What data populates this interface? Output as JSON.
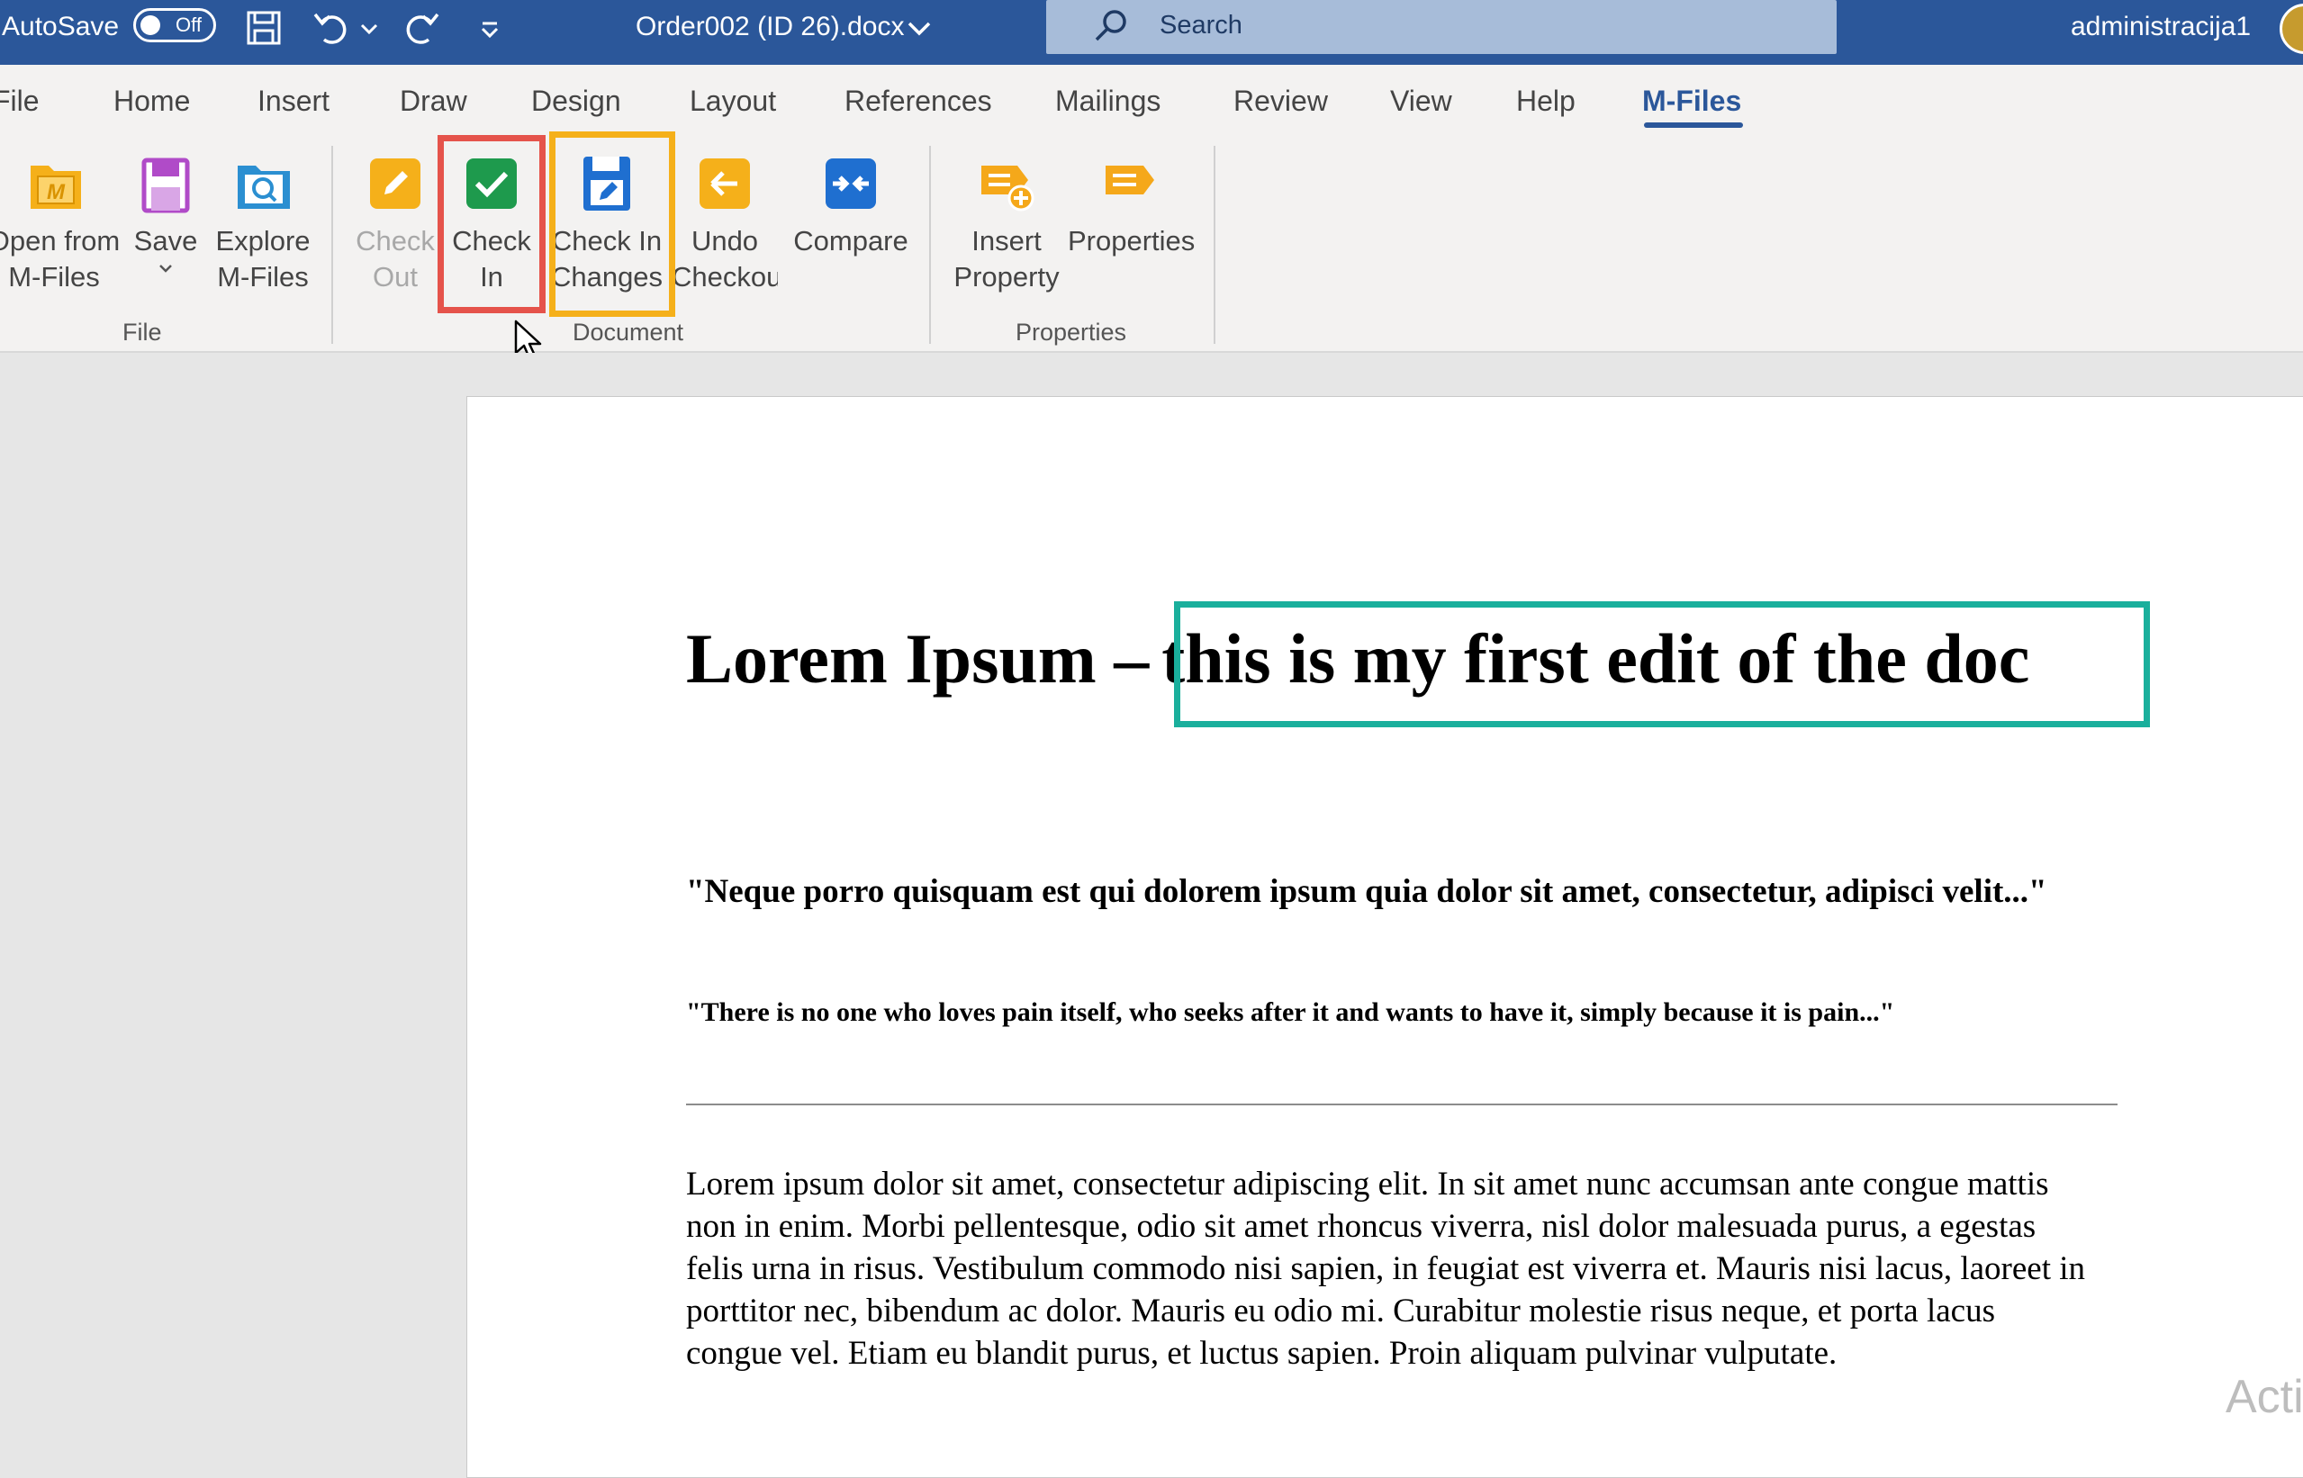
{
  "titlebar": {
    "autosave_label": "AutoSave",
    "autosave_state": "Off",
    "filename": "Order002 (ID 26).docx",
    "search_placeholder": "Search",
    "user_name": "administracija1",
    "icons": [
      "save-icon",
      "undo-icon",
      "undo-dropdown-icon",
      "redo-icon",
      "customize-quick-access-icon",
      "filename-dropdown-icon",
      "search-icon"
    ]
  },
  "tabs": {
    "file": "File",
    "home": "Home",
    "insert": "Insert",
    "draw": "Draw",
    "design": "Design",
    "layout": "Layout",
    "references": "References",
    "mailings": "Mailings",
    "review": "Review",
    "view": "View",
    "help": "Help",
    "mfiles": "M-Files",
    "active": "M-Files"
  },
  "ribbon": {
    "open_from_line1": "Open from",
    "open_from_line2": "M-Files",
    "save": "Save",
    "explore_line1": "Explore",
    "explore_line2": "M-Files",
    "group_file": "File",
    "checkout_line1": "Check",
    "checkout_line2": "Out",
    "checkin_line1": "Check",
    "checkin_line2": "In",
    "checkin_changes_line1": "Check In",
    "checkin_changes_line2": "Changes",
    "undo_checkout_line1": "Undo",
    "undo_checkout_line2": "Checkout",
    "compare": "Compare",
    "group_document": "Document",
    "insert_property_line1": "Insert",
    "insert_property_line2": "Property",
    "properties": "Properties",
    "group_properties": "Properties",
    "colors": {
      "mfiles_yellow": "#f5b01a",
      "save_purple": "#b04bc8",
      "explore_blue": "#2b8fd1",
      "checkin_green": "#1e9a4d",
      "checkin_changes_blue": "#1f6fd0",
      "compare_blue": "#1f6fd0",
      "property_orange": "#f5a81a"
    }
  },
  "document": {
    "title_main": "Lorem Ipsum –",
    "title_edit": "this is my first edit of the doc",
    "quote1": "\"Neque porro quisquam est qui dolorem ipsum quia dolor sit amet, consectetur, adipisci velit...\"",
    "quote2": "\"There is no one who loves pain itself, who seeks after it and wants to have it, simply because it is pain...\"",
    "body": "Lorem ipsum dolor sit amet, consectetur adipiscing elit. In sit amet nunc accumsan ante congue mattis non in enim. Morbi pellentesque, odio sit amet rhoncus viverra, nisl dolor malesuada purus, a egestas felis urna in risus. Vestibulum commodo nisi sapien, in feugiat est viverra et. Mauris nisi lacus, laoreet in porttitor nec, bibendum ac dolor. Mauris eu odio mi. Curabitur molestie risus neque, et porta lacus congue vel. Etiam eu blandit purus, et luctus sapien. Proin aliquam pulvinar vulputate."
  },
  "watermark": "Acti",
  "highlights": {
    "check_in": "#e5534b",
    "check_in_changes": "#f5b01a",
    "title_edit": "#1aaf9c"
  }
}
